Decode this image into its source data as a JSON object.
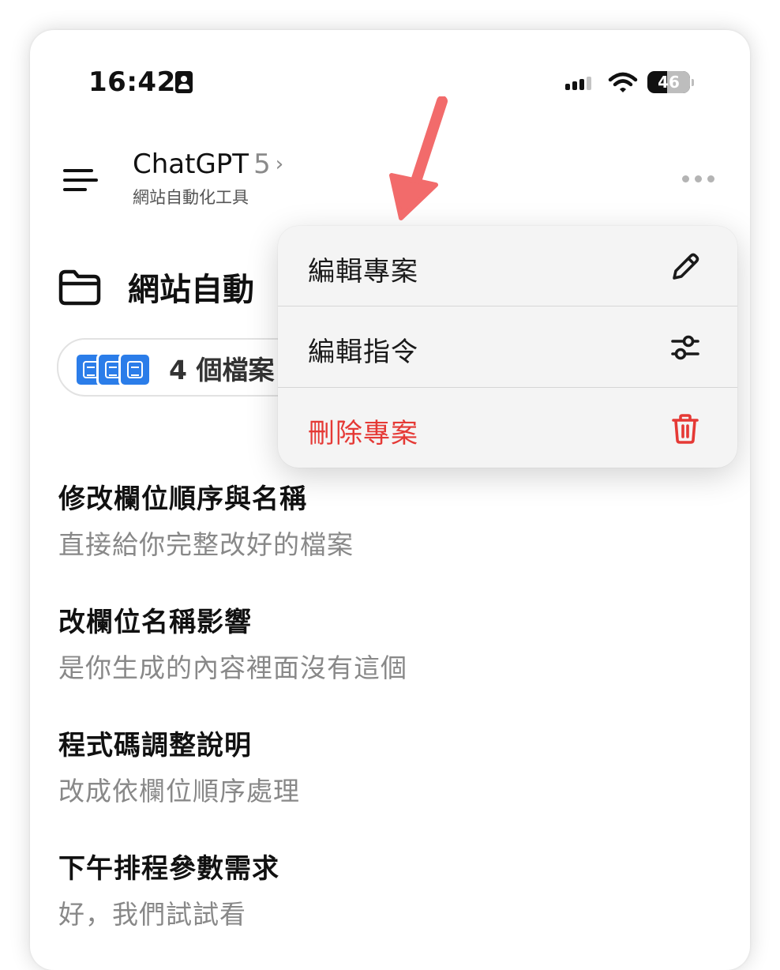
{
  "statusbar": {
    "time": "16:42",
    "battery_level": "46",
    "icons": [
      "id-card-icon",
      "cellular-signal-icon",
      "wifi-icon",
      "battery-icon"
    ]
  },
  "header": {
    "title": "ChatGPT",
    "model_version": "5",
    "chevron": "›",
    "subtitle": "網站自動化工具"
  },
  "project": {
    "name": "網站自動",
    "files_label": "4 個檔案"
  },
  "menu": {
    "items": [
      {
        "label": "編輯專案",
        "icon": "pencil-icon"
      },
      {
        "label": "編輯指令",
        "icon": "sliders-icon"
      },
      {
        "label": "刪除專案",
        "icon": "trash-icon",
        "color": "#e53935"
      }
    ]
  },
  "chats": [
    {
      "title": "修改欄位順序與名稱",
      "snippet": "直接給你完整改好的檔案"
    },
    {
      "title": "改欄位名稱影響",
      "snippet": "是你生成的內容裡面沒有這個"
    },
    {
      "title": "程式碼調整說明",
      "snippet": "改成依欄位順序處理"
    },
    {
      "title": "下午排程參數需求",
      "snippet": "好，我們試試看"
    }
  ],
  "colors": {
    "accent_blue": "#2b7de9",
    "danger_red": "#e53935",
    "annotation_arrow": "#f26b6b"
  }
}
